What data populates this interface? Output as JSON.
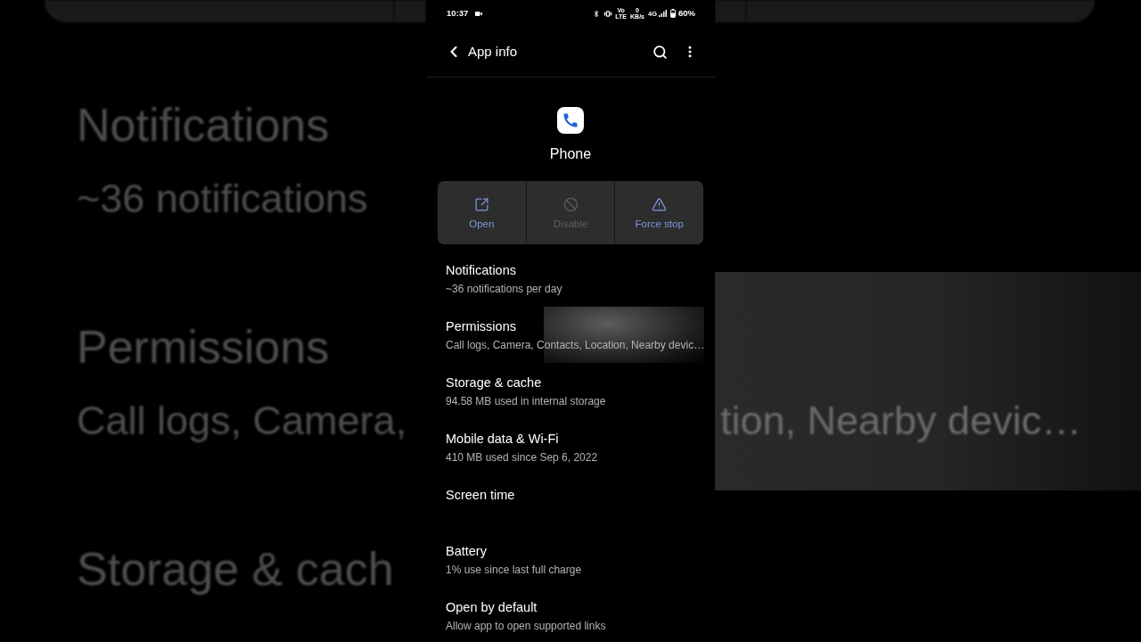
{
  "status_bar": {
    "time": "10:37",
    "volte": [
      "Vo",
      "LTE"
    ],
    "speed": [
      "0",
      "KB/s"
    ],
    "network": "4G",
    "battery": "60%"
  },
  "header": {
    "title": "App info"
  },
  "app": {
    "name": "Phone"
  },
  "actions": [
    {
      "label": "Open",
      "disabled": false
    },
    {
      "label": "Disable",
      "disabled": true
    },
    {
      "label": "Force stop",
      "disabled": false
    }
  ],
  "settings": [
    {
      "title": "Notifications",
      "subtitle": "~36 notifications per day",
      "pressed": false
    },
    {
      "title": "Permissions",
      "subtitle": "Call logs, Camera, Contacts, Location, Nearby devic…",
      "pressed": true
    },
    {
      "title": "Storage & cache",
      "subtitle": "94.58 MB used in internal storage",
      "pressed": false
    },
    {
      "title": "Mobile data & Wi-Fi",
      "subtitle": "410 MB used since Sep 6, 2022",
      "pressed": false
    },
    {
      "title": "Screen time",
      "pressed": false
    },
    {
      "title": "Battery",
      "subtitle": "1% use since last full charge",
      "pressed": false
    },
    {
      "title": "Open by default",
      "subtitle": "Allow app to open supported links",
      "pressed": false
    }
  ],
  "backdrop": {
    "left": [
      {
        "title": "Notifications",
        "subtitle": "~36 notifications"
      },
      {
        "title": "Permissions",
        "subtitle": "Call logs, Camera,"
      },
      {
        "title": "Storage & cach"
      }
    ],
    "right": [
      "tion, Nearby devic…"
    ]
  }
}
